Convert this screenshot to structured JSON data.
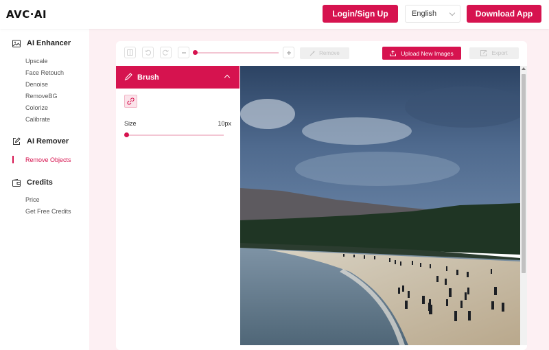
{
  "header": {
    "logo": "AVC·AI",
    "login_label": "Login/Sign Up",
    "language": "English",
    "download_label": "Download App"
  },
  "sidebar": {
    "sections": [
      {
        "title": "AI Enhancer",
        "icon": "image-icon",
        "items": [
          "Upscale",
          "Face Retouch",
          "Denoise",
          "RemoveBG",
          "Colorize",
          "Calibrate"
        ]
      },
      {
        "title": "AI Remover",
        "icon": "edit-icon",
        "items": [
          "Remove Objects"
        ]
      },
      {
        "title": "Credits",
        "icon": "wallet-icon",
        "items": [
          "Price",
          "Get Free Credits"
        ]
      }
    ],
    "active_item": "Remove Objects"
  },
  "toolbar": {
    "remove_label": "Remove",
    "upload_label": "Upload New Images",
    "export_label": "Export",
    "zoom_level": 0.0
  },
  "brush_panel": {
    "title": "Brush",
    "size_label": "Size",
    "size_value": "10px",
    "size_level": 0.0
  },
  "colors": {
    "accent": "#d6134f",
    "background_tint": "#fdf0f3"
  }
}
